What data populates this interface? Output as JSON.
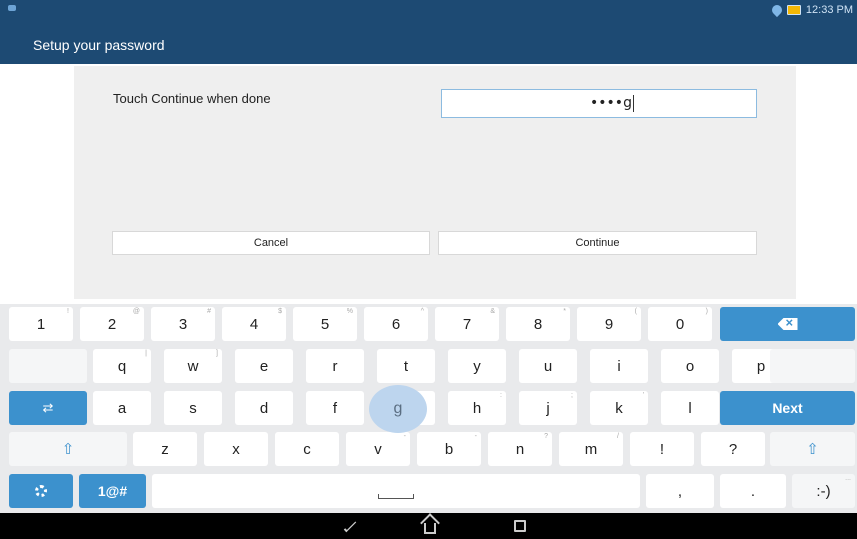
{
  "status_bar": {
    "time": "12:33 PM",
    "icons": [
      "notification-icon",
      "wifi-icon",
      "battery-icon"
    ]
  },
  "header": {
    "title": "Setup your password"
  },
  "dialog": {
    "prompt": "Touch Continue when done",
    "password_value": "••••g",
    "cancel_label": "Cancel",
    "continue_label": "Continue"
  },
  "keyboard": {
    "row1": [
      {
        "label": "1",
        "hint": "!"
      },
      {
        "label": "2",
        "hint": "@"
      },
      {
        "label": "3",
        "hint": "#"
      },
      {
        "label": "4",
        "hint": "$"
      },
      {
        "label": "5",
        "hint": "%"
      },
      {
        "label": "6",
        "hint": "^"
      },
      {
        "label": "7",
        "hint": "&"
      },
      {
        "label": "8",
        "hint": "*"
      },
      {
        "label": "9",
        "hint": "("
      },
      {
        "label": "0",
        "hint": ")"
      }
    ],
    "row2": [
      {
        "label": "q",
        "hint": "|"
      },
      {
        "label": "w",
        "hint": "]"
      },
      {
        "label": "e",
        "hint": ""
      },
      {
        "label": "r",
        "hint": ""
      },
      {
        "label": "t",
        "hint": ""
      },
      {
        "label": "y",
        "hint": ""
      },
      {
        "label": "u",
        "hint": ""
      },
      {
        "label": "i",
        "hint": ""
      },
      {
        "label": "o",
        "hint": ""
      },
      {
        "label": "p",
        "hint": "\""
      }
    ],
    "row3": [
      {
        "label": "a",
        "hint": ""
      },
      {
        "label": "s",
        "hint": ""
      },
      {
        "label": "d",
        "hint": ""
      },
      {
        "label": "f",
        "hint": ""
      },
      {
        "label": "g",
        "hint": ""
      },
      {
        "label": "h",
        "hint": ":"
      },
      {
        "label": "j",
        "hint": ";"
      },
      {
        "label": "k",
        "hint": "'"
      },
      {
        "label": "l",
        "hint": ""
      }
    ],
    "row4": [
      {
        "label": "z",
        "hint": ""
      },
      {
        "label": "x",
        "hint": ""
      },
      {
        "label": "c",
        "hint": ""
      },
      {
        "label": "v",
        "hint": "-"
      },
      {
        "label": "b",
        "hint": "-"
      },
      {
        "label": "n",
        "hint": "?"
      },
      {
        "label": "m",
        "hint": "/"
      },
      {
        "label": "!",
        "hint": ""
      },
      {
        "label": "?",
        "hint": ""
      }
    ],
    "next_label": "Next",
    "symbols_label": "1@#",
    "comma_label": ",",
    "period_label": ".",
    "smiley_label": ":-)",
    "smiley_hint": "...",
    "pressed_key": "g",
    "accent_color": "#3c91cd"
  },
  "nav_bar": {
    "icons": [
      "back-icon",
      "home-icon",
      "recents-icon"
    ]
  }
}
